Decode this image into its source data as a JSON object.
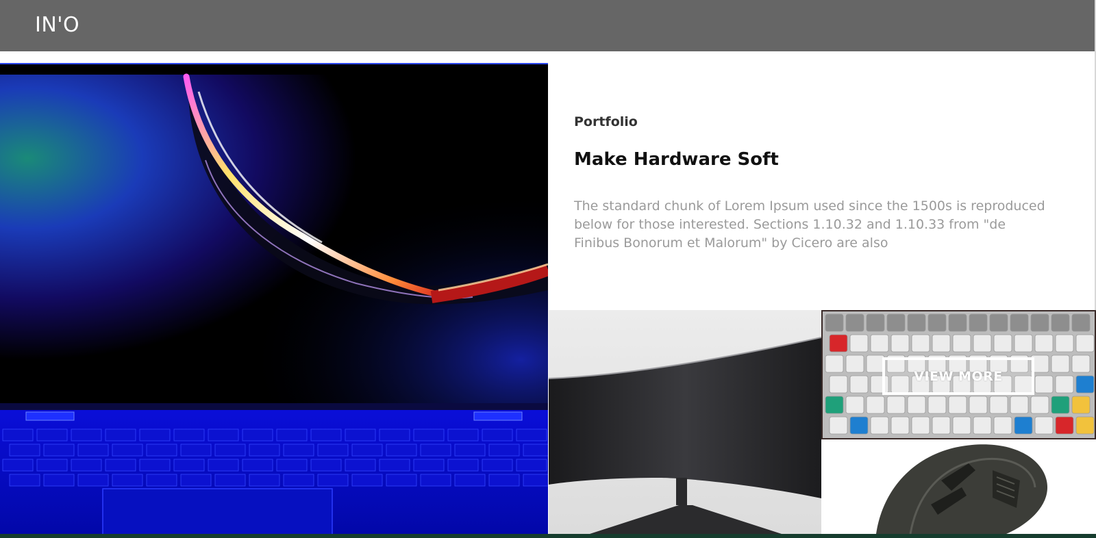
{
  "header": {
    "logo": "IN'O",
    "background": "#666666"
  },
  "main": {
    "eyebrow": "Portfolio",
    "title": "Make Hardware Soft",
    "description": "The standard chunk of Lorem Ipsum used since the 1500s is reproduced below for those interested. Sections 1.10.32 and 1.10.33 from \"de Finibus Bonorum et Malorum\" by Cicero are also"
  },
  "gallery": {
    "view_more_label": "VIEW MORE"
  },
  "colors": {
    "text_dark": "#111111",
    "text_muted": "#9a9a9a",
    "laptop_blue": "#0a18c8",
    "bottom_strip": "#163d2e"
  }
}
